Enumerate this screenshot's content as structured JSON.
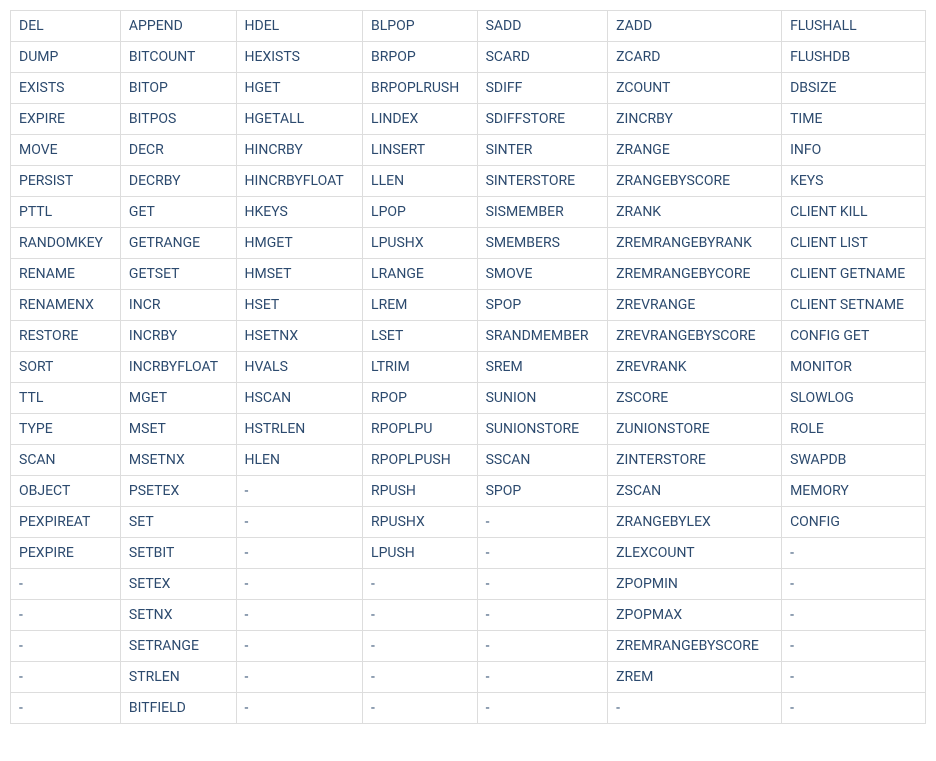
{
  "table": {
    "rows": [
      [
        "DEL",
        "APPEND",
        "HDEL",
        "BLPOP",
        "SADD",
        "ZADD",
        "FLUSHALL"
      ],
      [
        "DUMP",
        "BITCOUNT",
        "HEXISTS",
        "BRPOP",
        "SCARD",
        "ZCARD",
        "FLUSHDB"
      ],
      [
        "EXISTS",
        "BITOP",
        "HGET",
        "BRPOPLRUSH",
        "SDIFF",
        "ZCOUNT",
        "DBSIZE"
      ],
      [
        "EXPIRE",
        "BITPOS",
        "HGETALL",
        "LINDEX",
        "SDIFFSTORE",
        "ZINCRBY",
        "TIME"
      ],
      [
        "MOVE",
        "DECR",
        "HINCRBY",
        "LINSERT",
        "SINTER",
        "ZRANGE",
        "INFO"
      ],
      [
        "PERSIST",
        "DECRBY",
        "HINCRBYFLOAT",
        "LLEN",
        "SINTERSTORE",
        "ZRANGEBYSCORE",
        "KEYS"
      ],
      [
        "PTTL",
        "GET",
        "HKEYS",
        "LPOP",
        "SISMEMBER",
        "ZRANK",
        "CLIENT KILL"
      ],
      [
        "RANDOMKEY",
        "GETRANGE",
        "HMGET",
        "LPUSHX",
        "SMEMBERS",
        "ZREMRANGEBYRANK",
        "CLIENT LIST"
      ],
      [
        "RENAME",
        "GETSET",
        "HMSET",
        "LRANGE",
        "SMOVE",
        "ZREMRANGEBYCORE",
        "CLIENT GETNAME"
      ],
      [
        "RENAMENX",
        "INCR",
        "HSET",
        "LREM",
        "SPOP",
        "ZREVRANGE",
        "CLIENT SETNAME"
      ],
      [
        "RESTORE",
        "INCRBY",
        "HSETNX",
        "LSET",
        "SRANDMEMBER",
        "ZREVRANGEBYSCORE",
        "CONFIG GET"
      ],
      [
        "SORT",
        "INCRBYFLOAT",
        "HVALS",
        "LTRIM",
        "SREM",
        "ZREVRANK",
        "MONITOR"
      ],
      [
        "TTL",
        "MGET",
        "HSCAN",
        "RPOP",
        "SUNION",
        "ZSCORE",
        "SLOWLOG"
      ],
      [
        "TYPE",
        "MSET",
        "HSTRLEN",
        "RPOPLPU",
        "SUNIONSTORE",
        "ZUNIONSTORE",
        "ROLE"
      ],
      [
        "SCAN",
        "MSETNX",
        "HLEN",
        "RPOPLPUSH",
        "SSCAN",
        "ZINTERSTORE",
        "SWAPDB"
      ],
      [
        "OBJECT",
        "PSETEX",
        "-",
        "RPUSH",
        "SPOP",
        "ZSCAN",
        "MEMORY"
      ],
      [
        "PEXPIREAT",
        "SET",
        "-",
        "RPUSHX",
        "-",
        "ZRANGEBYLEX",
        "CONFIG"
      ],
      [
        "PEXPIRE",
        "SETBIT",
        "-",
        "LPUSH",
        "-",
        "ZLEXCOUNT",
        "-"
      ],
      [
        "-",
        "SETEX",
        "-",
        "-",
        "-",
        "ZPOPMIN",
        "-"
      ],
      [
        "-",
        "SETNX",
        "-",
        "-",
        "-",
        "ZPOPMAX",
        "-"
      ],
      [
        "-",
        "SETRANGE",
        "-",
        "-",
        "-",
        "ZREMRANGEBYSCORE",
        "-"
      ],
      [
        "-",
        "STRLEN",
        "-",
        "-",
        "-",
        "ZREM",
        "-"
      ],
      [
        "-",
        "BITFIELD",
        "-",
        "-",
        "-",
        "-",
        "-"
      ]
    ]
  }
}
